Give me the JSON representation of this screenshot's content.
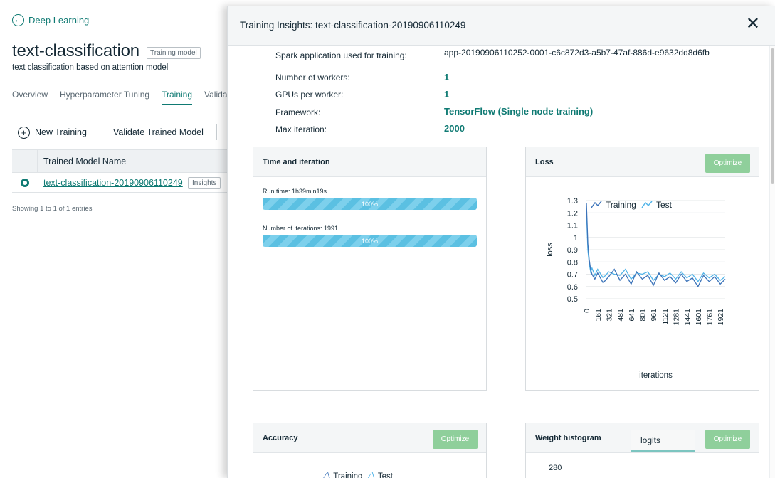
{
  "left": {
    "back_link": "Deep Learning",
    "title": "text-classification",
    "title_tag": "Training model",
    "subtitle": "text classification based on attention model",
    "tabs": [
      "Overview",
      "Hyperparameter Tuning",
      "Training",
      "Valida"
    ],
    "active_tab": "Training",
    "actions": {
      "new_training": "New Training",
      "validate": "Validate Trained Model"
    },
    "table": {
      "header": "Trained Model Name",
      "rows": [
        {
          "name": "text-classification-20190906110249",
          "tag": "Insights",
          "selected": true
        }
      ],
      "entries": "Showing 1 to 1 of 1 entries"
    }
  },
  "panel": {
    "title": "Training Insights: text-classification-20190906110249",
    "info": [
      {
        "label": "Spark application used for training:",
        "value": "app-20190906110252-0001-c6c872d3-a5b7-47af-886d-e9632dd8d6fb"
      },
      {
        "label": "Number of workers:",
        "value": "1"
      },
      {
        "label": "GPUs per worker:",
        "value": "1"
      },
      {
        "label": "Framework:",
        "value": "TensorFlow (Single node training)"
      },
      {
        "label": "Max iteration:",
        "value": "2000"
      }
    ],
    "time_card": {
      "title": "Time and iteration",
      "runtime_label": "Run time: 1h39min19s",
      "runtime_progress": 1.0,
      "runtime_text": "100%",
      "iterations_label": "Number of iterations: 1991",
      "iterations_progress": 1.0,
      "iterations_text": "100%"
    },
    "loss_card": {
      "title": "Loss",
      "optimize": "Optimize"
    },
    "accuracy_card": {
      "title": "Accuracy",
      "optimize": "Optimize",
      "legend": [
        "Training",
        "Test"
      ]
    },
    "weight_card": {
      "title": "Weight histogram",
      "tab": "logits",
      "optimize": "Optimize",
      "first_tick": "280"
    }
  },
  "chart_data": {
    "type": "line",
    "title": "",
    "xlabel": "iterations",
    "ylabel": "loss",
    "legend": [
      "Training",
      "Test"
    ],
    "legend_position": "top",
    "ylim": [
      0.5,
      1.3
    ],
    "y_ticks": [
      "1.3",
      "1.2",
      "1.1",
      "1",
      "0.9",
      "0.8",
      "0.7",
      "0.6",
      "0.5"
    ],
    "x_ticks": [
      "0",
      "161",
      "321",
      "481",
      "641",
      "801",
      "961",
      "1121",
      "1281",
      "1441",
      "1601",
      "1761",
      "1921"
    ],
    "grid": true,
    "series": [
      {
        "name": "Training",
        "color": "#3b73b9",
        "x": [
          0,
          20,
          40,
          60,
          80,
          120,
          161,
          240,
          321,
          400,
          481,
          560,
          641,
          720,
          801,
          880,
          961,
          1040,
          1121,
          1200,
          1281,
          1360,
          1441,
          1520,
          1601,
          1680,
          1761,
          1840,
          1921,
          1991
        ],
        "y": [
          1.28,
          0.95,
          0.82,
          0.74,
          0.7,
          0.66,
          0.71,
          0.63,
          0.68,
          0.74,
          0.65,
          0.7,
          0.62,
          0.72,
          0.66,
          0.69,
          0.61,
          0.71,
          0.65,
          0.68,
          0.63,
          0.7,
          0.64,
          0.67,
          0.6,
          0.69,
          0.64,
          0.68,
          0.62,
          0.66
        ]
      },
      {
        "name": "Test",
        "color": "#4fb3e8",
        "x": [
          0,
          20,
          40,
          60,
          80,
          120,
          161,
          240,
          321,
          400,
          481,
          560,
          641,
          720,
          801,
          880,
          961,
          1040,
          1121,
          1200,
          1281,
          1360,
          1441,
          1520,
          1601,
          1680,
          1761,
          1840,
          1921,
          1991
        ],
        "y": [
          1.22,
          0.9,
          0.79,
          0.72,
          0.75,
          0.69,
          0.74,
          0.67,
          0.72,
          0.7,
          0.69,
          0.74,
          0.66,
          0.71,
          0.7,
          0.72,
          0.65,
          0.7,
          0.68,
          0.71,
          0.66,
          0.72,
          0.67,
          0.7,
          0.64,
          0.71,
          0.67,
          0.7,
          0.65,
          0.68
        ]
      }
    ]
  },
  "colors": {
    "accent": "#0f7a73",
    "optimize_button": "#8fcf9b",
    "progress": "#5bc0e2"
  }
}
